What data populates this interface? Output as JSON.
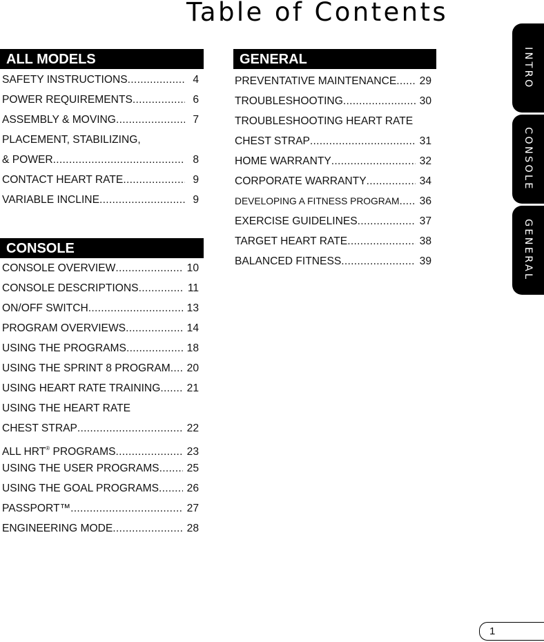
{
  "title": "Table of Contents",
  "sections": {
    "all_models": {
      "header": "ALL MODELS",
      "entries": [
        {
          "label": "SAFETY INSTRUCTIONS",
          "page": "4"
        },
        {
          "label": "POWER REQUIREMENTS",
          "page": "6"
        },
        {
          "label": "ASSEMBLY & MOVING",
          "page": "7"
        },
        {
          "label": "PLACEMENT, STABILIZING,",
          "page": ""
        },
        {
          "label": "& POWER",
          "page": "8"
        },
        {
          "label": "CONTACT HEART RATE",
          "page": "9"
        },
        {
          "label": "VARIABLE INCLINE",
          "page": "9"
        }
      ]
    },
    "console": {
      "header": "CONSOLE",
      "entries": [
        {
          "label": "CONSOLE OVERVIEW",
          "page": "10"
        },
        {
          "label": "CONSOLE DESCRIPTIONS",
          "page": "11"
        },
        {
          "label": "ON/OFF SWITCH",
          "page": "13"
        },
        {
          "label": "PROGRAM OVERVIEWS",
          "page": "14"
        },
        {
          "label": "USING THE PROGRAMS",
          "page": "18"
        },
        {
          "label": "USING THE SPRINT 8 PROGRAM",
          "page": "20"
        },
        {
          "label": "USING HEART RATE TRAINING",
          "page": "21"
        },
        {
          "label": "USING THE HEART RATE",
          "page": ""
        },
        {
          "label": "CHEST STRAP",
          "page": "22"
        },
        {
          "label": "ALL HRT",
          "sup": "®",
          "label_suffix": " PROGRAMS",
          "page": "23"
        },
        {
          "label": "USING THE USER PROGRAMS",
          "page": "25"
        },
        {
          "label": "USING THE GOAL PROGRAMS",
          "page": "26"
        },
        {
          "label": "PASSPORT™",
          "page": "27"
        },
        {
          "label": "ENGINEERING MODE",
          "page": "28"
        }
      ]
    },
    "general": {
      "header": "GENERAL",
      "entries": [
        {
          "label": "PREVENTATIVE MAINTENANCE",
          "page": "29"
        },
        {
          "label": "TROUBLESHOOTING",
          "page": "30"
        },
        {
          "label": "TROUBLESHOOTING HEART RATE",
          "page": ""
        },
        {
          "label": "CHEST STRAP",
          "page": "31"
        },
        {
          "label": "HOME WARRANTY",
          "page": "32"
        },
        {
          "label": "CORPORATE WARRANTY",
          "page": "34"
        },
        {
          "label": "DEVELOPING A FITNESS PROGRAM",
          "page": "36"
        },
        {
          "label": "EXERCISE GUIDELINES",
          "page": "37"
        },
        {
          "label": "TARGET HEART RATE",
          "page": "38"
        },
        {
          "label": "BALANCED FITNESS",
          "page": "39"
        }
      ]
    }
  },
  "side_tabs": [
    "INTRO",
    "CONSOLE",
    "GENERAL"
  ],
  "page_number": "1"
}
